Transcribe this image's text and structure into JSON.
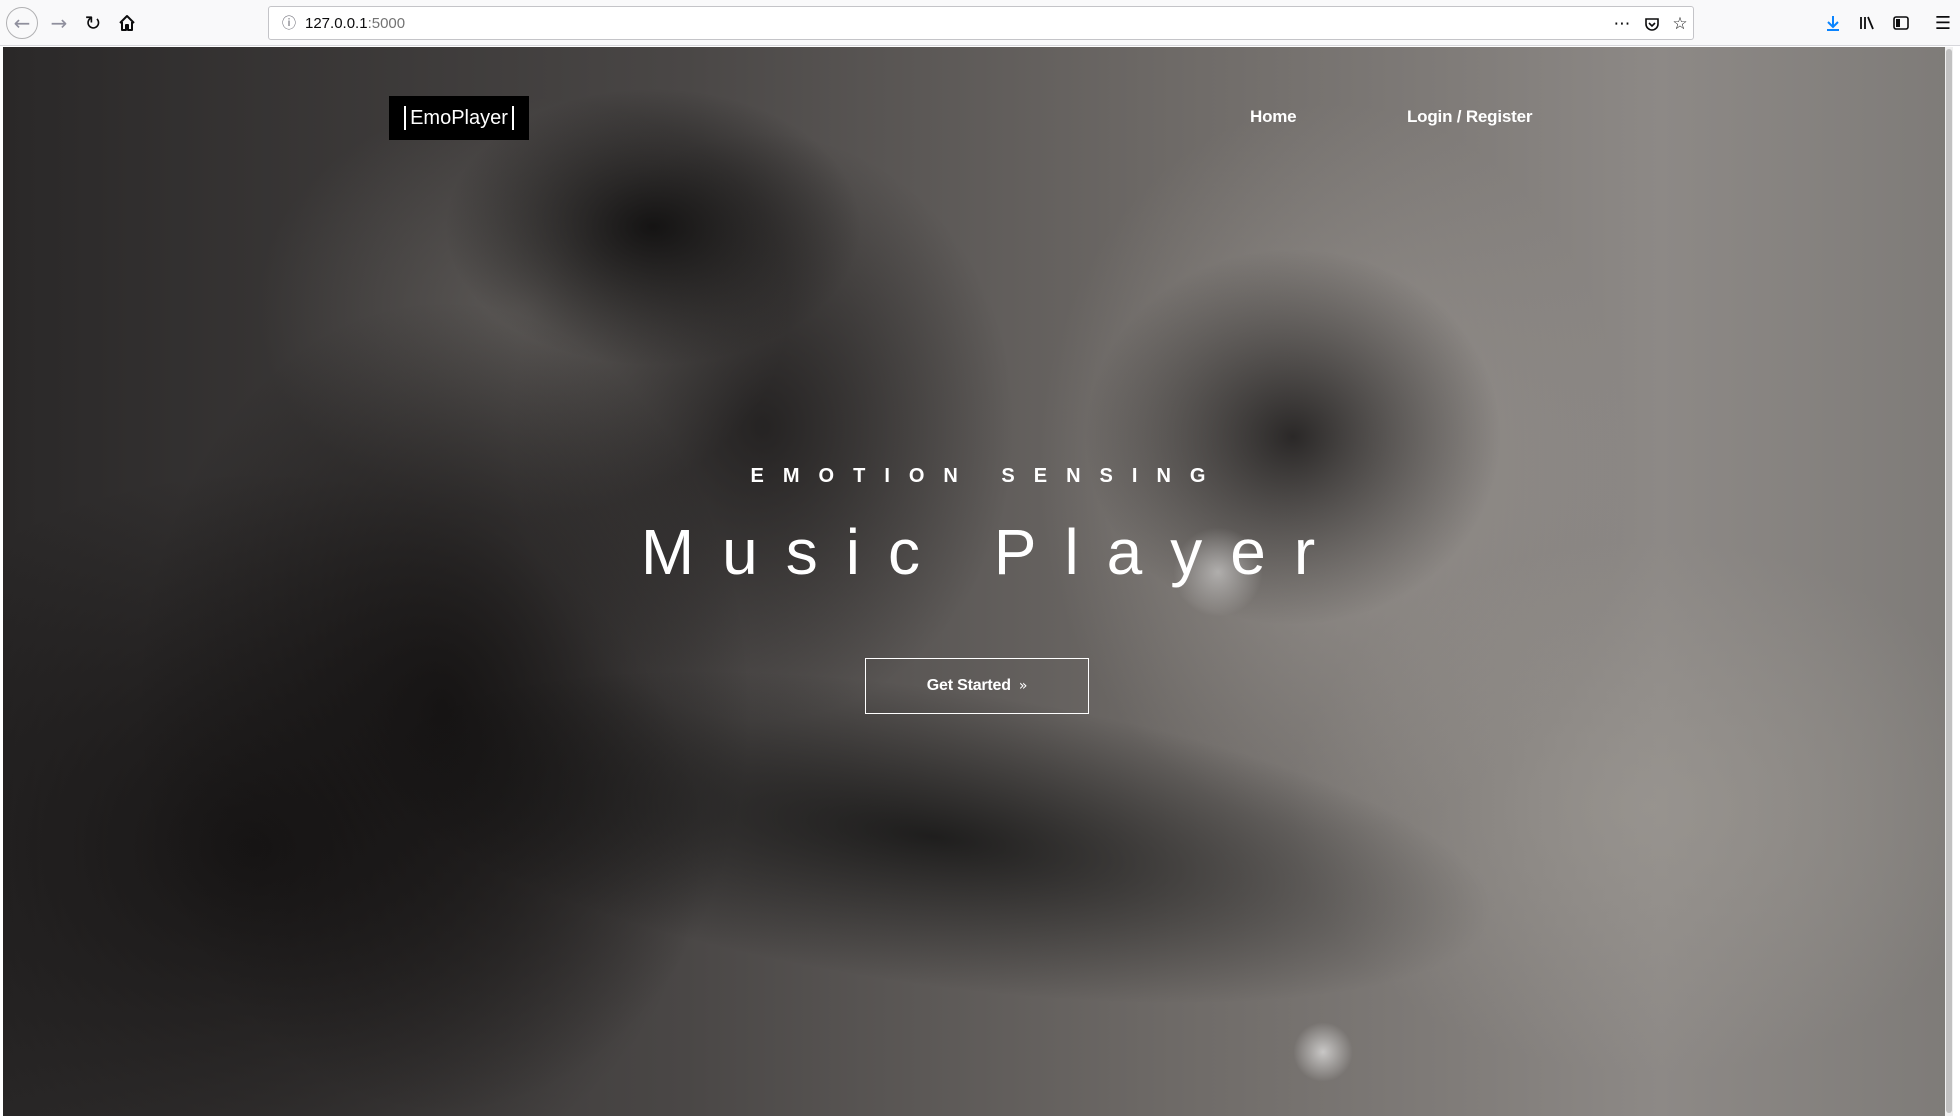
{
  "browser": {
    "url_host": "127.0.0.1",
    "url_port": ":5000",
    "icons": {
      "back": "back-arrow-icon",
      "forward": "forward-arrow-icon",
      "reload": "reload-icon",
      "home": "home-icon",
      "site_info": "info-icon",
      "page_actions": "more-icon",
      "pocket": "pocket-icon",
      "bookmark": "star-icon",
      "downloads": "download-icon",
      "library": "library-icon",
      "sidebar": "sidebar-icon",
      "menu": "hamburger-menu-icon"
    },
    "accent_color": "#0a84ff"
  },
  "page": {
    "brand": "EmoPlayer",
    "nav": {
      "home": "Home",
      "login": "Login / Register"
    },
    "hero": {
      "eyebrow": "EMOTION SENSING",
      "title": "Music Player",
      "cta_label": "Get Started",
      "cta_icon": "double-chevron-right-icon"
    }
  }
}
